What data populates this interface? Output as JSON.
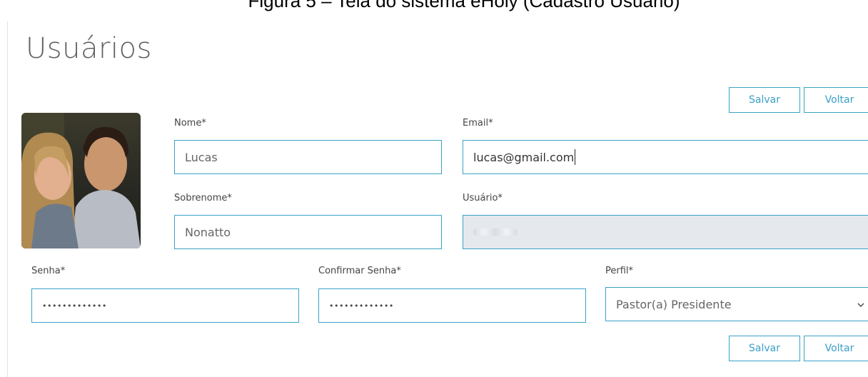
{
  "caption": "Figura 5 – Tela do sistema eHoly (Cadastro Usuário)",
  "page": {
    "title": "Usuários"
  },
  "actions_top": {
    "save": "Salvar",
    "back": "Voltar"
  },
  "actions_bottom": {
    "save": "Salvar",
    "back": "Voltar"
  },
  "form": {
    "nome": {
      "label": "Nome*",
      "value": "Lucas"
    },
    "email": {
      "label": "Email*",
      "value": "lucas@gmail.com"
    },
    "sobrenome": {
      "label": "Sobrenome*",
      "value": "Nonatto"
    },
    "usuario": {
      "label": "Usuário*",
      "value": ""
    },
    "senha": {
      "label": "Senha*",
      "value": "•••••••••••••"
    },
    "confirmar_senha": {
      "label": "Confirmar Senha*",
      "value": "•••••••••••••"
    },
    "perfil": {
      "label": "Perfil*",
      "selected": "Pastor(a) Presidente"
    }
  },
  "colors": {
    "accent": "#3aa3c6",
    "disabled_bg": "#e5e8ed",
    "title": "#616161"
  }
}
